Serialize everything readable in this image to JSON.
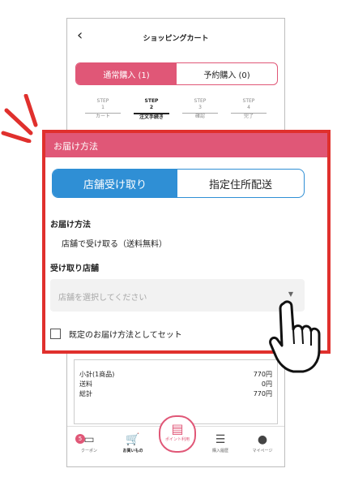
{
  "header": {
    "back_icon": "chevron-left-icon",
    "title": "ショッピングカート"
  },
  "purchase_tabs": [
    {
      "label": "通常購入 (1)"
    },
    {
      "label": "予約購入 (0)"
    }
  ],
  "steps": [
    {
      "step": "STEP",
      "num": "1",
      "label": "カート"
    },
    {
      "step": "STEP",
      "num": "2",
      "label": "注文手続き"
    },
    {
      "step": "STEP",
      "num": "3",
      "label": "確認"
    },
    {
      "step": "STEP",
      "num": "4",
      "label": "完了"
    }
  ],
  "popup": {
    "title": "お届け方法",
    "delivery_tabs": [
      {
        "label": "店舗受け取り"
      },
      {
        "label": "指定住所配送"
      }
    ],
    "method_label": "お届け方法",
    "method_value": "店舗で受け取る（送料無料）",
    "store_label": "受け取り店舗",
    "store_placeholder": "店舗を選択してください",
    "default_checkbox_label": "既定のお届け方法としてセット"
  },
  "summary": {
    "rows": [
      {
        "label": "小計(1商品)",
        "value": "770円"
      },
      {
        "label": "送料",
        "value": "0円"
      },
      {
        "label": "総計",
        "value": "770円"
      }
    ]
  },
  "tabbar": {
    "coupon": {
      "label": "クーポン",
      "badge": "5"
    },
    "shopping": {
      "label": "お買いもの"
    },
    "point": {
      "label": "ポイント利用"
    },
    "history": {
      "label": "購入履歴"
    },
    "mypage": {
      "label": "マイページ"
    }
  },
  "colors": {
    "accent_pink": "#e05777",
    "accent_blue": "#2f8fd5",
    "highlight_red": "#e0302d"
  }
}
